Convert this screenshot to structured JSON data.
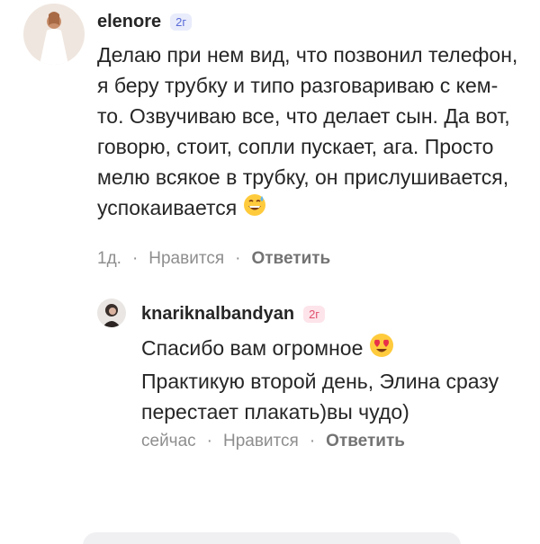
{
  "comments": [
    {
      "username": "elenore",
      "badge": "2г",
      "text": "Делаю при нем вид, что позвонил телефон, я беру трубку и типо разговариваю с кем-то. Озвучиваю все, что делает сын. Да вот, говорю, стоит, сопли пускает, ага. Просто мелю всякое в трубку, он прислушивается, успокаивается",
      "emoji": "grinning-sweat-emoji",
      "time": "1д.",
      "like_label": "Нравится",
      "reply_label": "Ответить"
    },
    {
      "username": "knariknalbandyan",
      "badge": "2г",
      "text_line1": "Спасибо вам огромное",
      "emoji": "heart-eyes-emoji",
      "text_rest": "Практикую второй день,  Элина сразу перестает плакать)вы чудо)",
      "time": "сейчас",
      "like_label": "Нравится",
      "reply_label": "Ответить"
    }
  ],
  "separator": "·",
  "colors": {
    "text": "#262626",
    "meta": "#8e8e8e",
    "badge_1_bg": "#e8ecfb",
    "badge_1_fg": "#5a6bd8",
    "badge_2_bg": "#fde4ea",
    "badge_2_fg": "#e0506e"
  }
}
